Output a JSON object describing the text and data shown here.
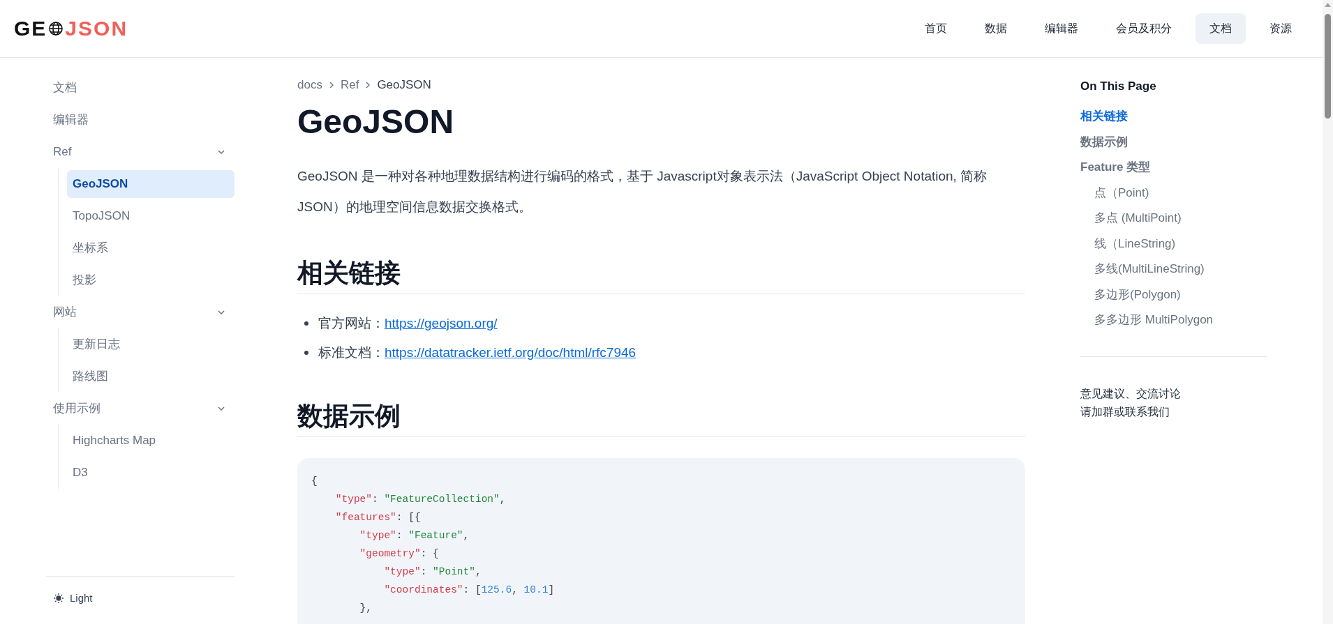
{
  "logo": {
    "left": "GE",
    "right": "JSON"
  },
  "nav": [
    {
      "label": "首页",
      "selected": false
    },
    {
      "label": "数据",
      "selected": false
    },
    {
      "label": "编辑器",
      "selected": false
    },
    {
      "label": "会员及积分",
      "selected": false
    },
    {
      "label": "文档",
      "selected": true
    },
    {
      "label": "资源",
      "selected": false
    }
  ],
  "sidebar": {
    "items": [
      {
        "label": "文档",
        "selected": false
      },
      {
        "label": "编辑器",
        "selected": false
      },
      {
        "label": "Ref",
        "selected": false,
        "expanded": true,
        "children": [
          {
            "label": "GeoJSON",
            "selected": true
          },
          {
            "label": "TopoJSON",
            "selected": false
          },
          {
            "label": "坐标系",
            "selected": false
          },
          {
            "label": "投影",
            "selected": false
          }
        ]
      },
      {
        "label": "网站",
        "selected": false,
        "expanded": true,
        "children": [
          {
            "label": "更新日志",
            "selected": false
          },
          {
            "label": "路线图",
            "selected": false
          }
        ]
      },
      {
        "label": "使用示例",
        "selected": false,
        "expanded": true,
        "children": [
          {
            "label": "Highcharts Map",
            "selected": false
          },
          {
            "label": "D3",
            "selected": false
          }
        ]
      }
    ],
    "theme_toggle": "Light"
  },
  "breadcrumb": [
    "docs",
    "Ref",
    "GeoJSON"
  ],
  "title": "GeoJSON",
  "intro": "GeoJSON 是一种对各种地理数据结构进行编码的格式，基于 Javascript对象表示法（JavaScript Object Notation, 简称 JSON）的地理空间信息数据交换格式。",
  "sections": [
    {
      "heading": "相关链接",
      "links": [
        {
          "label": "官方网站：",
          "url": "https://geojson.org/"
        },
        {
          "label": "标准文档：",
          "url": "https://datatracker.ietf.org/doc/html/rfc7946"
        }
      ]
    },
    {
      "heading": "数据示例",
      "code": [
        [
          {
            "kind": "punct",
            "text": "{"
          }
        ],
        [
          {
            "kind": "key",
            "text": "    \"type\""
          },
          {
            "kind": "punct",
            "text": ": "
          },
          {
            "kind": "string",
            "text": "\"FeatureCollection\""
          },
          {
            "kind": "punct",
            "text": ","
          }
        ],
        [
          {
            "kind": "key",
            "text": "    \"features\""
          },
          {
            "kind": "punct",
            "text": ": [{"
          }
        ],
        [
          {
            "kind": "key",
            "text": "        \"type\""
          },
          {
            "kind": "punct",
            "text": ": "
          },
          {
            "kind": "string",
            "text": "\"Feature\""
          },
          {
            "kind": "punct",
            "text": ","
          }
        ],
        [
          {
            "kind": "key",
            "text": "        \"geometry\""
          },
          {
            "kind": "punct",
            "text": ": {"
          }
        ],
        [
          {
            "kind": "key",
            "text": "            \"type\""
          },
          {
            "kind": "punct",
            "text": ": "
          },
          {
            "kind": "string",
            "text": "\"Point\""
          },
          {
            "kind": "punct",
            "text": ","
          }
        ],
        [
          {
            "kind": "key",
            "text": "            \"coordinates\""
          },
          {
            "kind": "punct",
            "text": ": ["
          },
          {
            "kind": "number",
            "text": "125.6"
          },
          {
            "kind": "punct",
            "text": ", "
          },
          {
            "kind": "number",
            "text": "10.1"
          },
          {
            "kind": "punct",
            "text": "]"
          }
        ],
        [
          {
            "kind": "punct",
            "text": "        },"
          }
        ]
      ]
    }
  ],
  "toc": {
    "title": "On This Page",
    "items": [
      {
        "label": "相关链接",
        "selected": true
      },
      {
        "label": "数据示例",
        "selected": false
      },
      {
        "label": "Feature 类型",
        "selected": false,
        "children": [
          {
            "label": "点（Point)",
            "selected": false
          },
          {
            "label": "多点 (MultiPoint)",
            "selected": false
          },
          {
            "label": "线（LineString)",
            "selected": false
          },
          {
            "label": "多线(MultiLineString)",
            "selected": false
          },
          {
            "label": "多边形(Polygon)",
            "selected": false
          },
          {
            "label": "多多边形 MultiPolygon",
            "selected": false
          }
        ]
      }
    ],
    "feedback": [
      "意见建议、交流讨论",
      "请加群或联系我们"
    ]
  }
}
